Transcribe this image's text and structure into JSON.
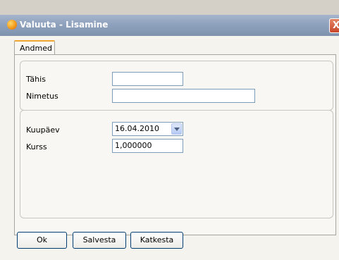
{
  "window": {
    "title": "Valuuta - Lisamine",
    "close_glyph": "X",
    "icon": "app-orange-ball-icon"
  },
  "tabs": [
    {
      "label": "Andmed",
      "active": true
    }
  ],
  "form": {
    "group1": {
      "tahis": {
        "label": "Tähis",
        "value": ""
      },
      "nimetus": {
        "label": "Nimetus",
        "value": ""
      }
    },
    "group2": {
      "kuupaev": {
        "label": "Kuupäev",
        "value": "16.04.2010"
      },
      "kurss": {
        "label": "Kurss",
        "value": "1,000000"
      }
    }
  },
  "buttons": {
    "ok": "Ok",
    "save": "Salvesta",
    "cancel": "Katkesta"
  },
  "colors": {
    "titlebar": "#8fa2bd",
    "tab_accent": "#f0a632",
    "close_button": "#c7452a",
    "field_border": "#7f9db9"
  }
}
